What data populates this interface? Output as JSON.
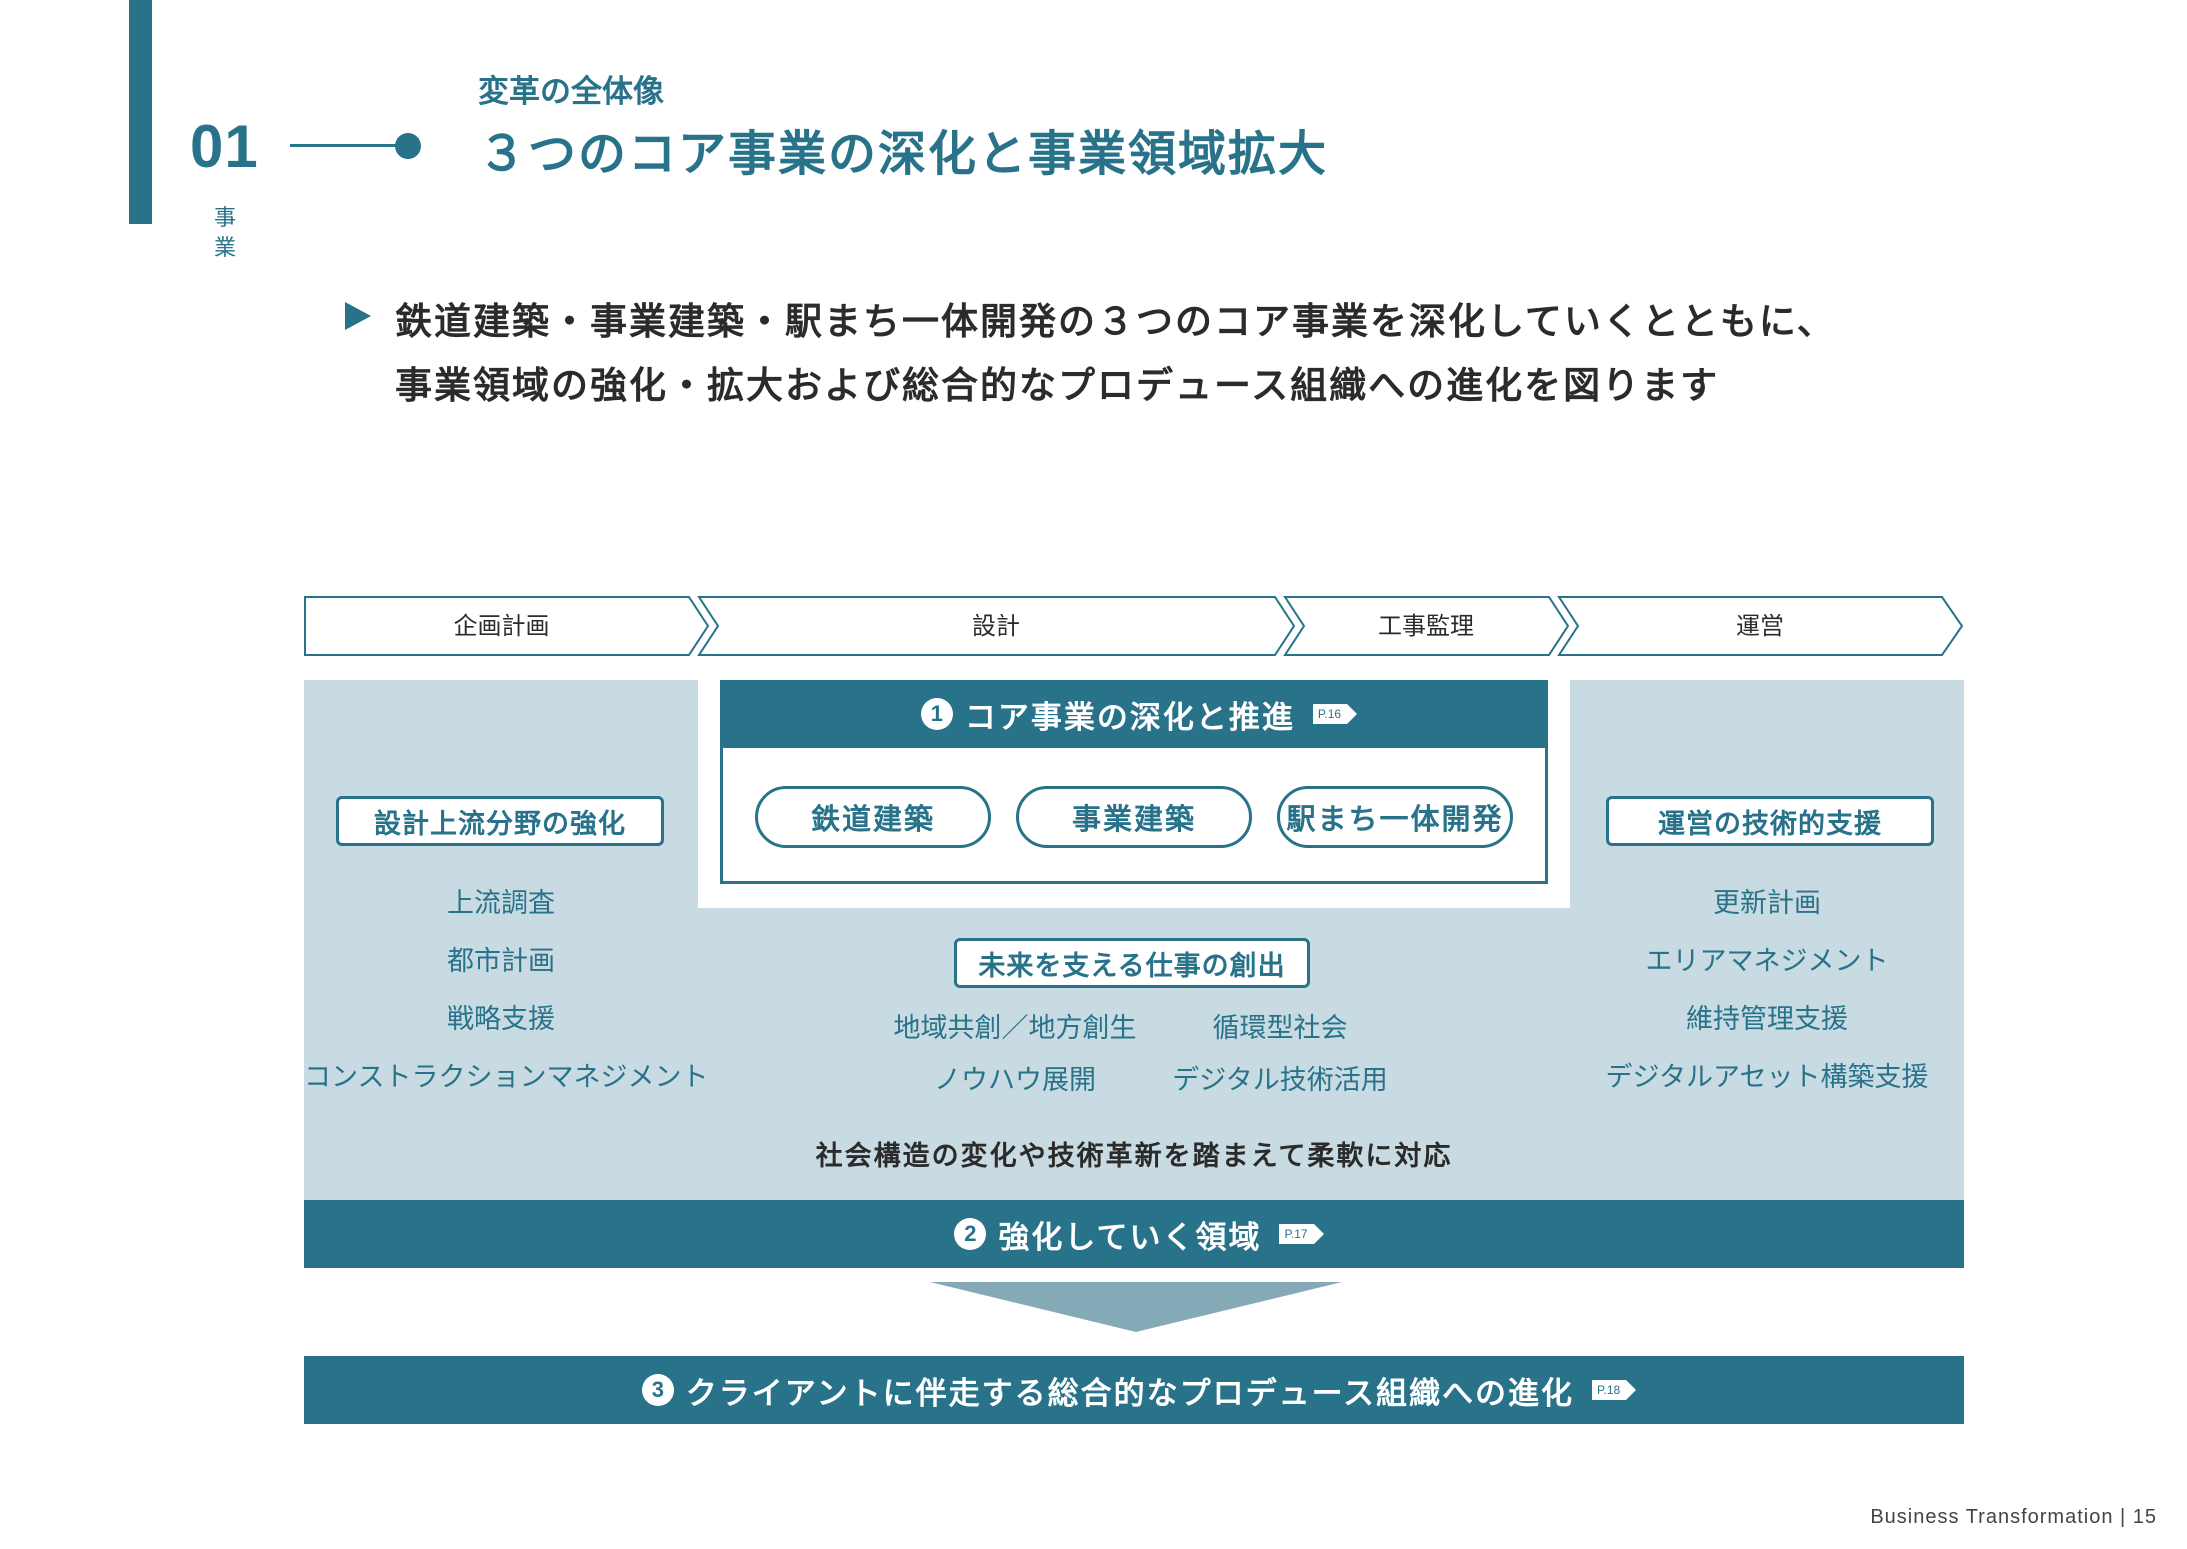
{
  "header": {
    "section_number": "01",
    "section_label": "事業",
    "kicker": "変革の全体像",
    "title": "３つのコア事業の深化と事業領域拡大"
  },
  "lead": {
    "line1": "鉄道建築・事業建築・駅まち一体開発の３つのコア事業を深化していくとともに、",
    "line2": "事業領域の強化・拡大および総合的なプロデュース組織への進化を図ります"
  },
  "process": [
    "企画計画",
    "設計",
    "工事監理",
    "運営"
  ],
  "core": {
    "number": "1",
    "title": "コア事業の深化と推進",
    "page_ref": "P.16",
    "items": [
      "鉄道建築",
      "事業建築",
      "駅まち一体開発"
    ]
  },
  "left": {
    "title": "設計上流分野の強化",
    "items": [
      "上流調査",
      "都市計画",
      "戦略支援",
      "コンストラクションマネジメント"
    ]
  },
  "right": {
    "title": "運営の技術的支援",
    "items": [
      "更新計画",
      "エリアマネジメント",
      "維持管理支援",
      "デジタルアセット構築支援"
    ]
  },
  "future": {
    "title": "未来を支える仕事の創出",
    "items": [
      "地域共創／地方創生",
      "循環型社会",
      "ノウハウ展開",
      "デジタル技術活用"
    ]
  },
  "flex_note": "社会構造の変化や技術革新を踏まえて柔軟に対応",
  "band2": {
    "number": "2",
    "title": "強化していく領域",
    "page_ref": "P.17"
  },
  "band3": {
    "number": "3",
    "title": "クライアントに伴走する総合的なプロデュース組織への進化",
    "page_ref": "P.18"
  },
  "footer": "Business Transformation | 15",
  "colors": {
    "accent": "#28728a",
    "panel": "#c8dbe2",
    "arrow": "#84aab7"
  }
}
